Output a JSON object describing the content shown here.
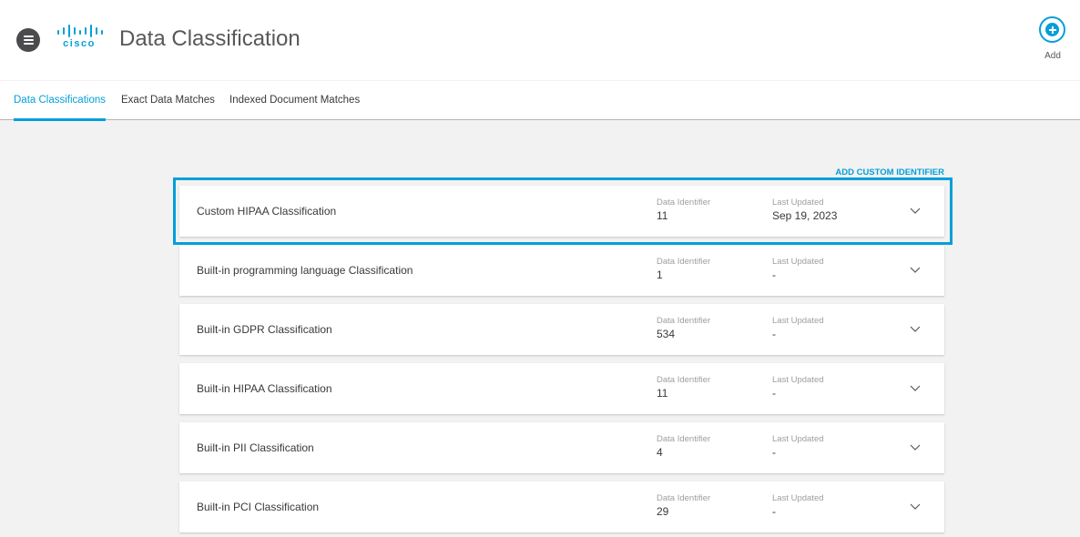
{
  "header": {
    "logo_text": "cisco",
    "title": "Data Classification",
    "add_label": "Add"
  },
  "tabs": [
    {
      "label": "Data Classifications",
      "active": true
    },
    {
      "label": "Exact Data Matches",
      "active": false
    },
    {
      "label": "Indexed Document Matches",
      "active": false
    }
  ],
  "actions": {
    "add_custom_identifier": "ADD CUSTOM IDENTIFIER"
  },
  "labels": {
    "data_identifier": "Data Identifier",
    "last_updated": "Last Updated"
  },
  "classifications": [
    {
      "name": "Custom HIPAA Classification",
      "data_identifier": "11",
      "last_updated": "Sep 19, 2023",
      "selected": true
    },
    {
      "name": "Built-in programming language Classification",
      "data_identifier": "1",
      "last_updated": "-"
    },
    {
      "name": "Built-in GDPR Classification",
      "data_identifier": "534",
      "last_updated": "-"
    },
    {
      "name": "Built-in HIPAA Classification",
      "data_identifier": "11",
      "last_updated": "-"
    },
    {
      "name": "Built-in PII Classification",
      "data_identifier": "4",
      "last_updated": "-"
    },
    {
      "name": "Built-in PCI Classification",
      "data_identifier": "29",
      "last_updated": "-"
    }
  ],
  "colors": {
    "accent": "#049fd9",
    "background": "#f2f2f2",
    "text": "#39393b"
  },
  "icons": {
    "menu": "hamburger-menu-icon",
    "add": "plus-circle-icon",
    "expand": "chevron-down-icon"
  }
}
